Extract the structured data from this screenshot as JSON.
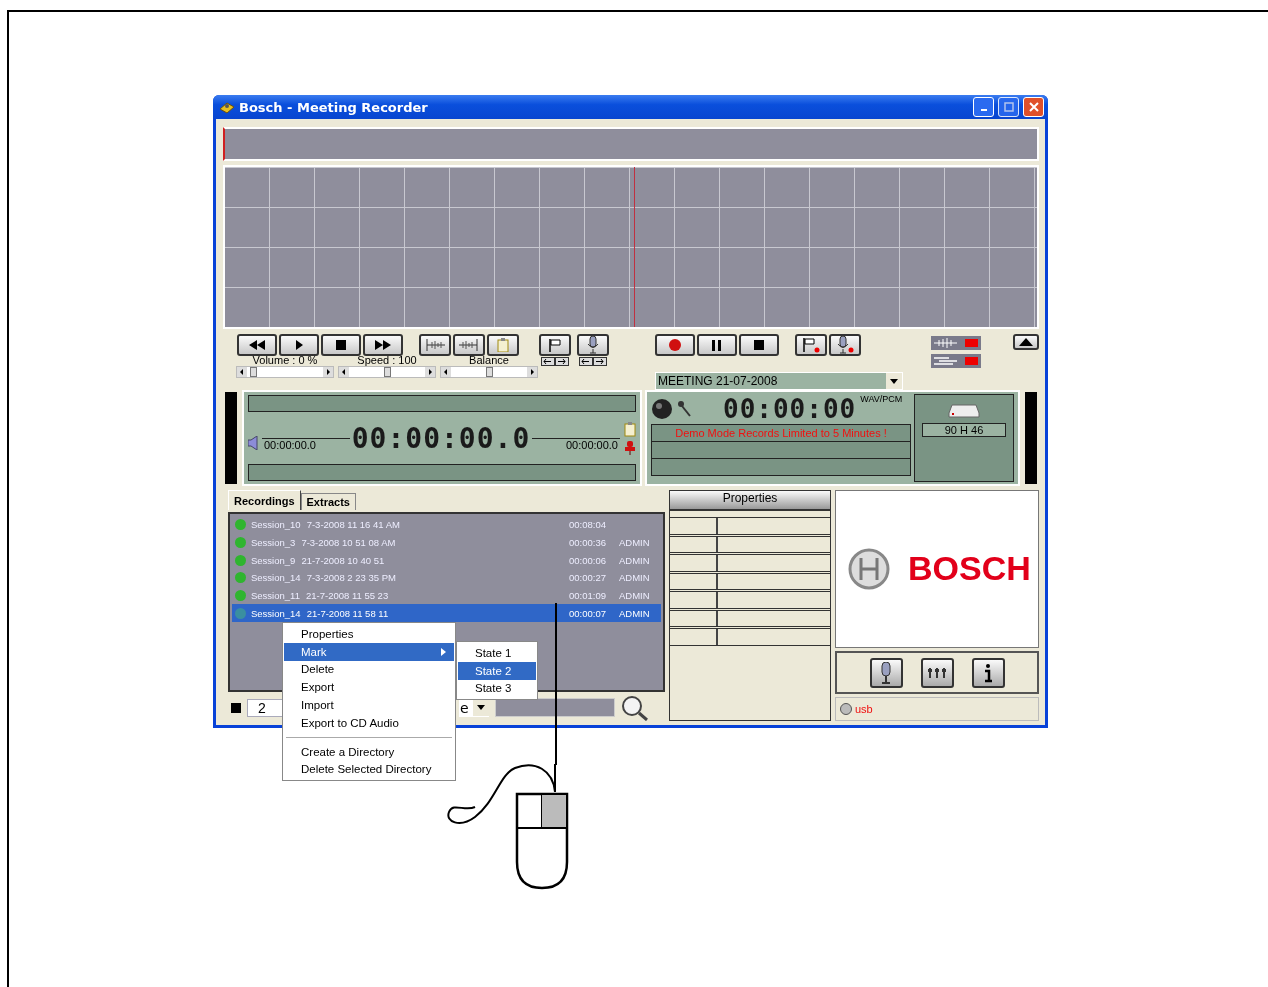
{
  "window": {
    "title": "Bosch - Meeting Recorder"
  },
  "playback": {
    "sliders": [
      {
        "label": "Volume : 0 %",
        "level": 0.05
      },
      {
        "label": "Speed : 100",
        "level": 0.5
      },
      {
        "label": "Balance",
        "level": 0.5
      }
    ],
    "start_time": "00:00:00.0",
    "counter": "00:00:00.0",
    "end_time": "00:00:00.0"
  },
  "recorder": {
    "meeting": "MEETING 21-07-2008",
    "counter": "00:00:00",
    "format": "WAV/PCM",
    "message": "Demo Mode Records Limited to 5 Minutes !",
    "disk_space": "90 H 46"
  },
  "tabs": [
    {
      "label": "Recordings",
      "selected": true
    },
    {
      "label": "Extracts",
      "selected": false
    }
  ],
  "recordings": [
    {
      "name": "Session_10",
      "date": "7-3-2008 11 16 41 AM",
      "duration": "00:08:04",
      "color": "#2fb52f",
      "selected": false
    },
    {
      "name": "Session_3",
      "date": "7-3-2008 10 51 08 AM",
      "duration": "00:00:36",
      "user": "ADMIN",
      "color": "#2fb52f",
      "selected": false
    },
    {
      "name": "Session_9",
      "date": "21-7-2008 10 40 51",
      "duration": "00:00:06",
      "user": "ADMIN",
      "color": "#2fb52f",
      "selected": false
    },
    {
      "name": "Session_14",
      "date": "7-3-2008 2 23 35 PM",
      "duration": "00:00:27",
      "user": "ADMIN",
      "color": "#2fb52f",
      "selected": false
    },
    {
      "name": "Session_11",
      "date": "21-7-2008 11 55 23",
      "duration": "00:01:09",
      "user": "ADMIN",
      "color": "#2fb52f",
      "selected": false
    },
    {
      "name": "Session_14",
      "date": "21-7-2008 11 58 11",
      "duration": "00:00:07",
      "user": "ADMIN",
      "color": "#3a8fa0",
      "selected": true
    }
  ],
  "context_menu": {
    "groups": [
      [
        {
          "label": "Properties",
          "selected": false
        },
        {
          "label": "Mark",
          "selected": true,
          "submenu": true
        },
        {
          "label": "Delete",
          "selected": false
        },
        {
          "label": "Export",
          "selected": false
        },
        {
          "label": "Import",
          "selected": false
        },
        {
          "label": "Export to CD Audio",
          "selected": false
        }
      ],
      [
        {
          "label": "Create a Directory",
          "selected": false
        },
        {
          "label": "Delete Selected Directory",
          "selected": false
        }
      ]
    ]
  },
  "submenu": {
    "items": [
      {
        "label": "State 1",
        "selected": false
      },
      {
        "label": "State 2",
        "selected": true
      },
      {
        "label": "State 3",
        "selected": false
      }
    ]
  },
  "search_bar": {
    "number": "2",
    "filter": "e"
  },
  "properties": {
    "title": "Properties"
  },
  "logo": {
    "text": "BOSCH"
  },
  "status": {
    "label": "usb"
  }
}
